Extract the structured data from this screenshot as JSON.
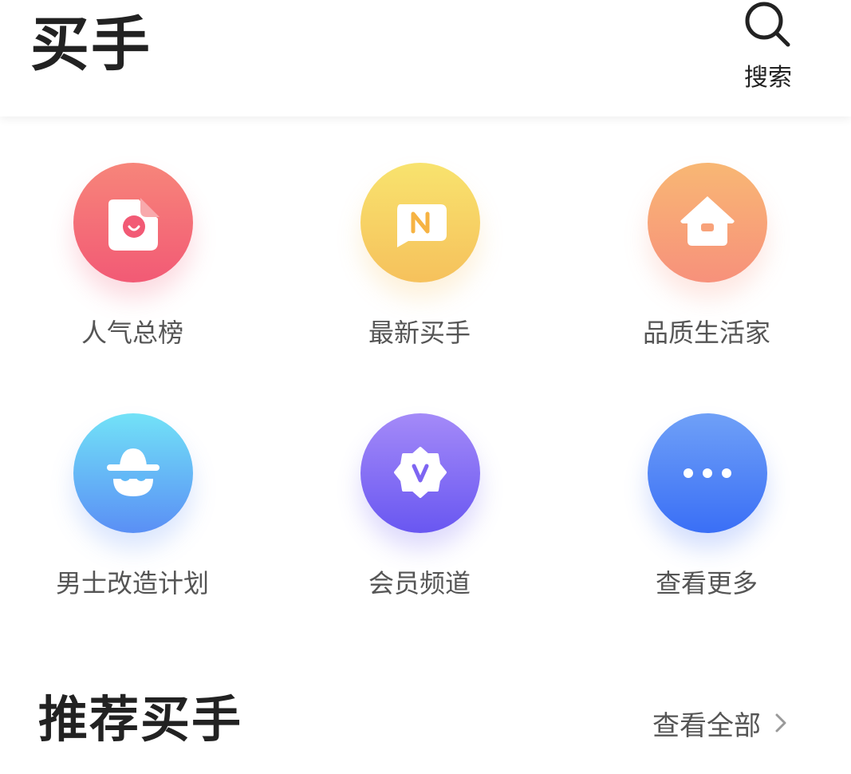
{
  "header": {
    "title": "买手",
    "search_label": "搜索",
    "search_icon": "search-icon"
  },
  "categories": [
    {
      "label": "人气总榜",
      "icon": "document-smile-icon",
      "color": "#f25a75"
    },
    {
      "label": "最新买手",
      "icon": "new-message-icon",
      "color": "#f6c15c"
    },
    {
      "label": "品质生活家",
      "icon": "house-icon",
      "color": "#f7917b"
    },
    {
      "label": "男士改造计划",
      "icon": "hat-face-icon",
      "color": "#5a8ff5"
    },
    {
      "label": "会员频道",
      "icon": "vip-badge-icon",
      "color": "#6957f1"
    },
    {
      "label": "查看更多",
      "icon": "more-dots-icon",
      "color": "#3a6ff6"
    }
  ],
  "recommended": {
    "title": "推荐买手",
    "view_all_label": "查看全部",
    "chevron_icon": "chevron-right-icon"
  }
}
